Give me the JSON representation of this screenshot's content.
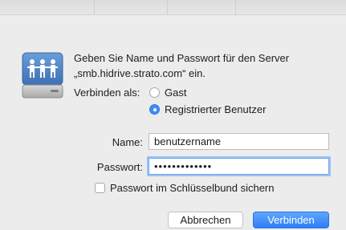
{
  "message": {
    "line1": "Geben Sie Name und Passwort für den Server",
    "line2": "„smb.hidrive.strato.com“ ein."
  },
  "connect_as": {
    "label": "Verbinden als:",
    "options": [
      "Gast",
      "Registrierter Benutzer"
    ],
    "selected": "Registrierter Benutzer"
  },
  "name": {
    "label": "Name:",
    "value": "benutzername"
  },
  "password": {
    "label": "Passwort:",
    "value": "•••••••••••••"
  },
  "keychain": {
    "label": "Passwort im Schlüsselbund sichern",
    "checked": false
  },
  "buttons": {
    "cancel": "Abbrechen",
    "connect": "Verbinden"
  },
  "icon": "shared-server-icon",
  "colors": {
    "accent": "#2e7ff5",
    "background": "#ececec"
  }
}
